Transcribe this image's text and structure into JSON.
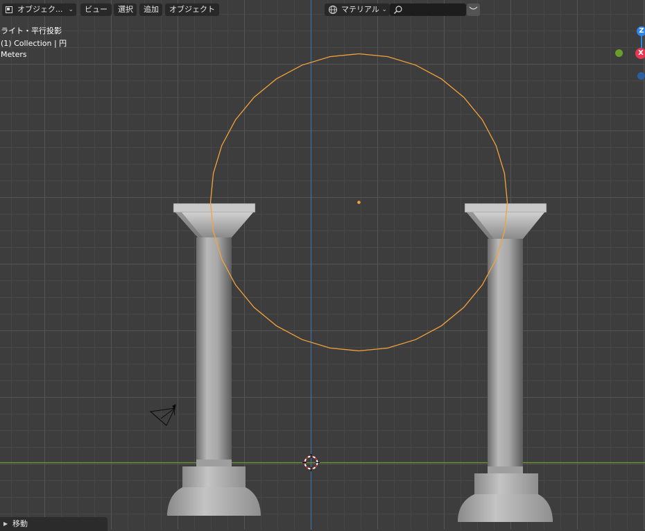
{
  "header": {
    "mode_label": "オブジェク...",
    "menu_view": "ビュー",
    "menu_select": "選択",
    "menu_add": "追加",
    "menu_object": "オブジェクト",
    "shading_label": "マテリアル",
    "search_value": ""
  },
  "viewport_info": {
    "view_name": "ライト・平行投影",
    "collection": "(1) Collection | 円",
    "units": "Meters"
  },
  "gizmo": {
    "z_label": "Z",
    "x_label": "X"
  },
  "operator_panel": {
    "label": "移動"
  },
  "colors": {
    "background": "#3d3d3d",
    "selection": "#f5a33a",
    "axis_z": "#2e85e6",
    "axis_x": "#e63650",
    "axis_y": "#6a9e2a",
    "ground_line": "#6f9a2e"
  }
}
